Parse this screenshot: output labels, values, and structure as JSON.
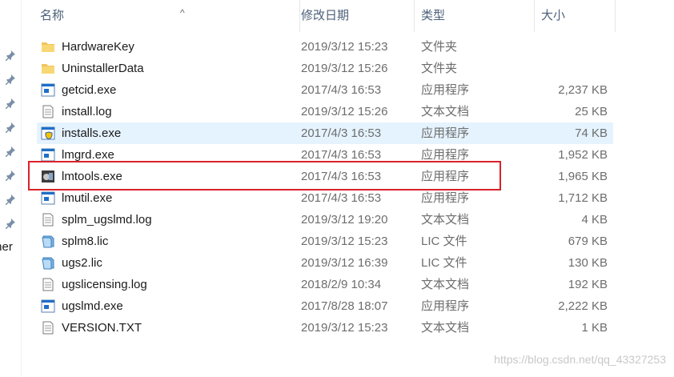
{
  "header": {
    "name": "名称",
    "modified": "修改日期",
    "type": "类型",
    "size": "大小",
    "sort_arrow": "^"
  },
  "nav": {
    "cut_text": "ther",
    "pins": [
      "pin-icon",
      "pin-icon",
      "pin-icon",
      "pin-icon",
      "pin-icon",
      "pin-icon",
      "pin-icon",
      "pin-icon"
    ]
  },
  "files": [
    {
      "name": "HardwareKey",
      "date": "2019/3/12 15:23",
      "type": "文件夹",
      "size": "",
      "icon": "folder-icon"
    },
    {
      "name": "UninstallerData",
      "date": "2019/3/12 15:26",
      "type": "文件夹",
      "size": "",
      "icon": "folder-icon"
    },
    {
      "name": "getcid.exe",
      "date": "2017/4/3 16:53",
      "type": "应用程序",
      "size": "2,237 KB",
      "icon": "exe-icon"
    },
    {
      "name": "install.log",
      "date": "2019/3/12 15:26",
      "type": "文本文档",
      "size": "25 KB",
      "icon": "text-file-icon"
    },
    {
      "name": "installs.exe",
      "date": "2017/4/3 16:53",
      "type": "应用程序",
      "size": "74 KB",
      "icon": "shield-exe-icon"
    },
    {
      "name": "lmgrd.exe",
      "date": "2017/4/3 16:53",
      "type": "应用程序",
      "size": "1,952 KB",
      "icon": "exe-icon"
    },
    {
      "name": "lmtools.exe",
      "date": "2017/4/3 16:53",
      "type": "应用程序",
      "size": "1,965 KB",
      "icon": "tools-exe-icon"
    },
    {
      "name": "lmutil.exe",
      "date": "2017/4/3 16:53",
      "type": "应用程序",
      "size": "1,712 KB",
      "icon": "exe-icon"
    },
    {
      "name": "splm_ugslmd.log",
      "date": "2019/3/12 19:20",
      "type": "文本文档",
      "size": "4 KB",
      "icon": "text-file-icon"
    },
    {
      "name": "splm8.lic",
      "date": "2019/3/12 15:23",
      "type": "LIC 文件",
      "size": "679 KB",
      "icon": "lic-file-icon"
    },
    {
      "name": "ugs2.lic",
      "date": "2019/3/12 16:39",
      "type": "LIC 文件",
      "size": "130 KB",
      "icon": "lic-file-icon"
    },
    {
      "name": "ugslicensing.log",
      "date": "2018/2/9 10:34",
      "type": "文本文档",
      "size": "192 KB",
      "icon": "text-file-icon"
    },
    {
      "name": "ugslmd.exe",
      "date": "2017/8/28 18:07",
      "type": "应用程序",
      "size": "2,222 KB",
      "icon": "exe-icon"
    },
    {
      "name": "VERSION.TXT",
      "date": "2019/3/12 15:23",
      "type": "文本文档",
      "size": "1 KB",
      "icon": "text-file-icon"
    }
  ],
  "selected_index": 4,
  "watermark": "https://blog.csdn.net/qq_43327253",
  "colors": {
    "selection": "#e5f3ff",
    "highlight_box": "#d9222a",
    "folder": "#f2c55c",
    "exe_blue": "#1e6fc7",
    "header_text": "#4c607a"
  }
}
